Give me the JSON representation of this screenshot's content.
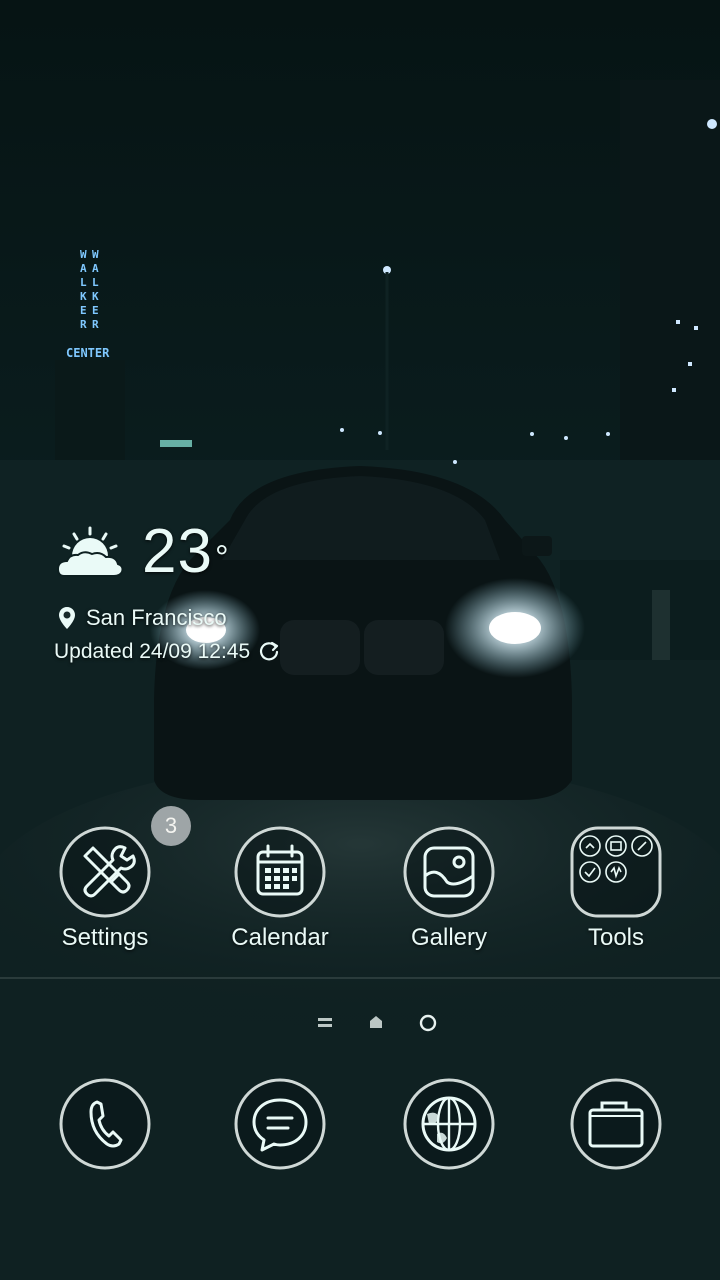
{
  "weather": {
    "temperature": "23",
    "degree": "°",
    "location": "San Francisco",
    "updated": "Updated 24/09 12:45",
    "icon": "partly-cloudy-icon"
  },
  "apps": [
    {
      "label": "Settings",
      "icon": "settings-tools-icon",
      "badge": "3"
    },
    {
      "label": "Calendar",
      "icon": "calendar-icon"
    },
    {
      "label": "Gallery",
      "icon": "gallery-icon"
    },
    {
      "label": "Tools",
      "icon": "tools-folder-icon"
    }
  ],
  "dock": [
    {
      "icon": "phone-icon"
    },
    {
      "icon": "messages-icon"
    },
    {
      "icon": "browser-globe-icon"
    },
    {
      "icon": "camera-icon"
    }
  ],
  "page_indicator": [
    "menu-indicator",
    "home-indicator",
    "page-dot"
  ],
  "wallpaper": {
    "sign_text": "CENTER",
    "sign_vertical": "WALKER",
    "theme": "dark-car-night"
  },
  "colors": {
    "text": "#eafaf7",
    "badge": "#aab0b2",
    "accent": "#cfe9e4"
  }
}
